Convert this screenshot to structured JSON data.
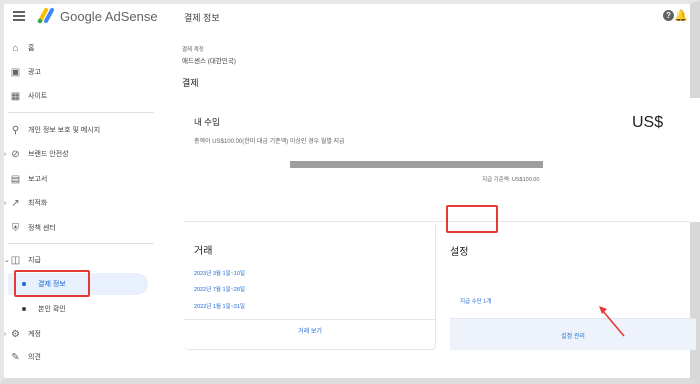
{
  "header": {
    "app_name": "Google AdSense",
    "page_title": "결제 정보",
    "help_icon": "help-icon",
    "bell_icon": "notifications-icon",
    "help_glyph": "?"
  },
  "sidebar": {
    "items": [
      {
        "label": "홈",
        "icon": "home-icon"
      },
      {
        "label": "광고",
        "icon": "ads-icon"
      },
      {
        "label": "사이트",
        "icon": "sites-icon"
      },
      {
        "label": "개인 정보 보호 및 메시지",
        "icon": "privacy-icon"
      },
      {
        "label": "브랜드 안전성",
        "icon": "block-icon"
      },
      {
        "label": "보고서",
        "icon": "reports-icon"
      },
      {
        "label": "최적화",
        "icon": "trending-icon"
      },
      {
        "label": "정책 센터",
        "icon": "policy-shield-icon"
      },
      {
        "label": "지급",
        "icon": "payments-icon"
      },
      {
        "label": "결제 정보",
        "icon": "dot"
      },
      {
        "label": "본인 확인",
        "icon": "dot"
      },
      {
        "label": "계정",
        "icon": "settings-gear-icon"
      },
      {
        "label": "의견",
        "icon": "feedback-icon"
      }
    ]
  },
  "main": {
    "account_label": "결제 계정",
    "account_value": "애드센스 (대한민국)",
    "section_title": "결제",
    "income": {
      "title": "내 수입",
      "description": "총액이 US$100.00(한미 대금 기준액) 이상인 경우 월별 지급",
      "amount": "US$",
      "progress_label": "지급 기준액: US$100.00",
      "progress_fraction": 1.0
    },
    "transactions": {
      "title": "거래",
      "links": [
        "2023년 3월 1일~10일",
        "2022년 7월 1일~28일",
        "2022년 1월 1일~31일"
      ],
      "footer": "거래 보기"
    },
    "settings": {
      "title": "설정",
      "payment_method": "지급 수단 1개",
      "footer": "설정 관리"
    }
  },
  "annotations": {
    "highlight_color": "#e53935"
  }
}
